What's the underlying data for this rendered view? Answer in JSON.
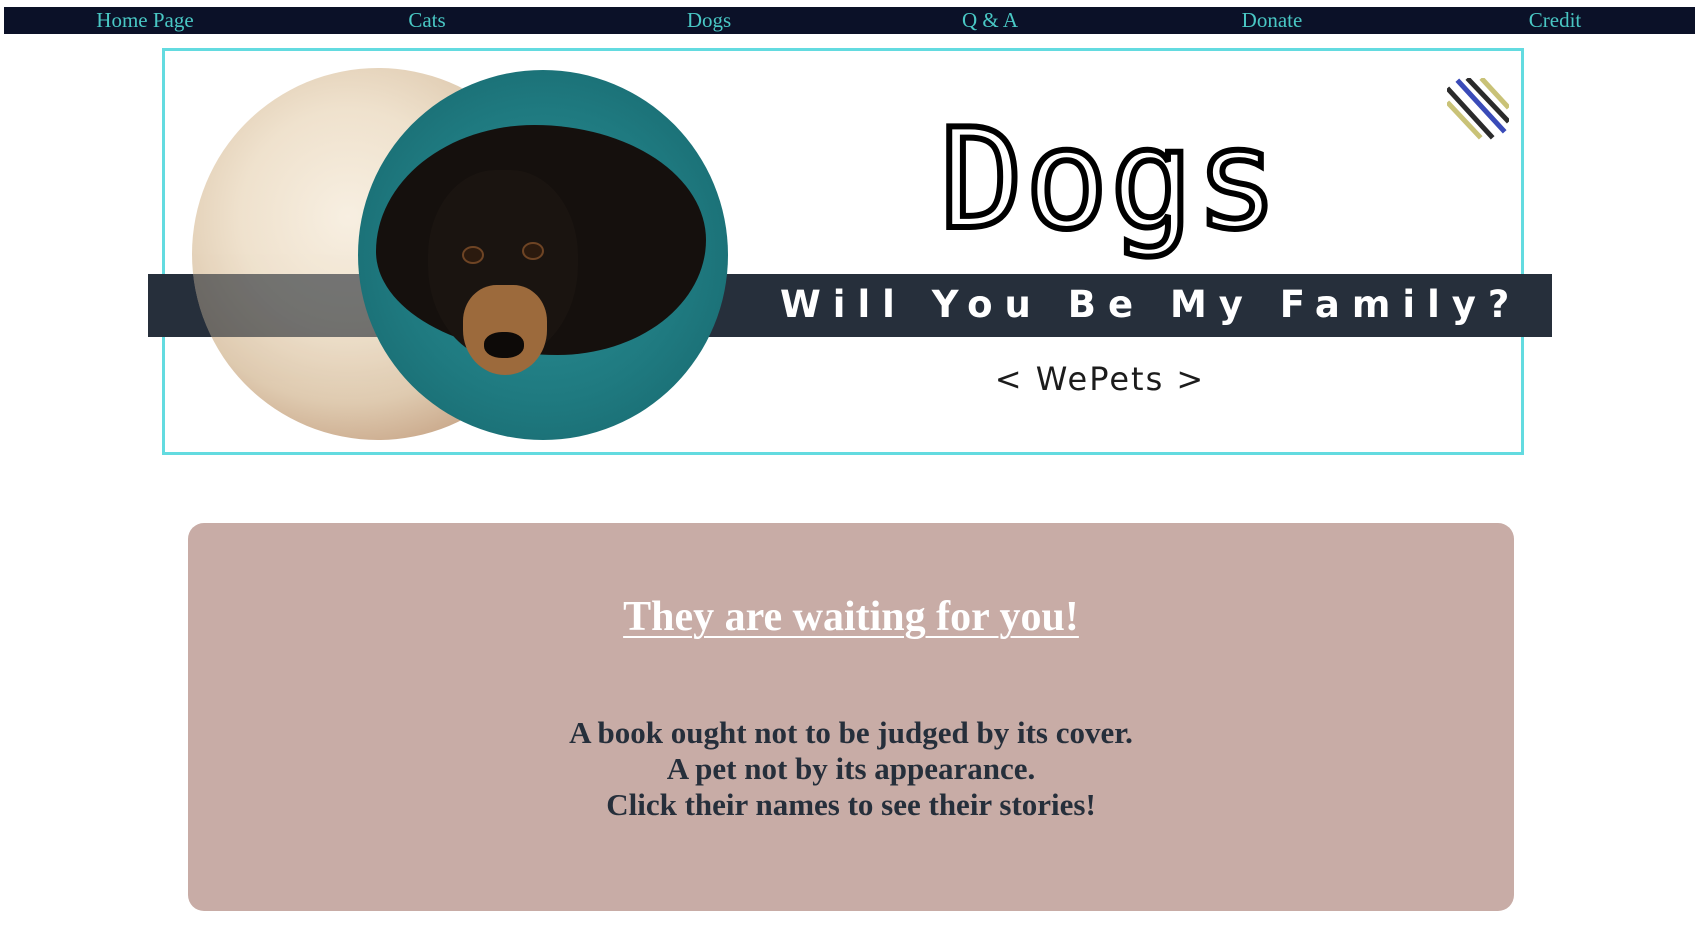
{
  "nav": {
    "items": [
      {
        "label": "Home Page"
      },
      {
        "label": "Cats"
      },
      {
        "label": "Dogs"
      },
      {
        "label": "Q & A"
      },
      {
        "label": "Donate"
      },
      {
        "label": "Credit"
      }
    ]
  },
  "banner": {
    "title": "Dogs",
    "tagline": "Will You Be My Family?",
    "brand": "< WePets >"
  },
  "card": {
    "heading": "They are waiting for you!",
    "lines": [
      "A book ought not to be judged by its cover.",
      "A pet not by its appearance.",
      "Click their names to see their stories!"
    ]
  },
  "colors": {
    "nav_bg": "#0b1128",
    "nav_text": "#49c7c4",
    "banner_border": "#63dbe0",
    "band": "#262f3b",
    "card_bg": "#c8aca6",
    "card_heading": "#ffffff",
    "card_text": "#262f3b"
  },
  "icons": {
    "banner_corner": "striped-diagonal-icon"
  }
}
